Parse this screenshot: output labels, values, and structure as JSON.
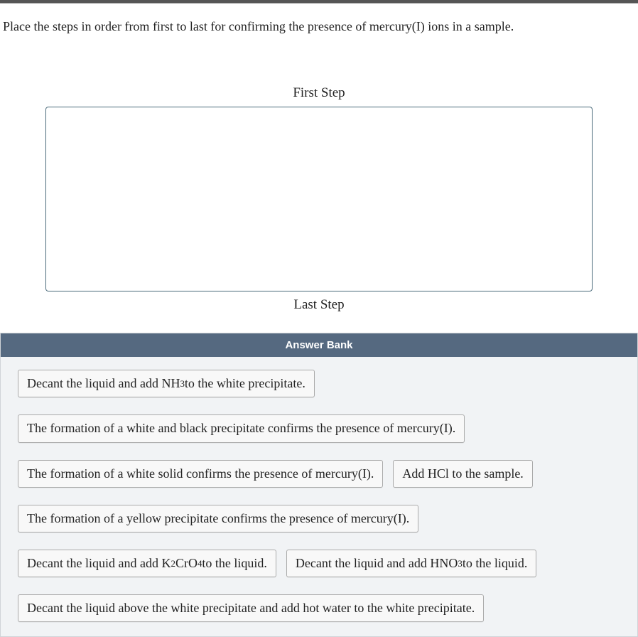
{
  "question": "Place the steps in order from first to last for confirming the presence of mercury(I) ions in a sample.",
  "labels": {
    "first": "First Step",
    "last": "Last Step",
    "bank": "Answer Bank"
  },
  "chips": {
    "c1a": "Decant the liquid and add NH",
    "c1b": " to the white precipitate.",
    "c1sub": "3",
    "c2": "The formation of a white and black precipitate confirms the presence of mercury(I).",
    "c3": "The formation of a white solid confirms the presence of mercury(I).",
    "c4": "Add HCl to the sample.",
    "c5": "The formation of a yellow precipitate confirms the presence of mercury(I).",
    "c6a": "Decant the liquid and add K",
    "c6s1": "2",
    "c6b": "CrO",
    "c6s2": "4",
    "c6c": " to the liquid.",
    "c7a": "Decant the liquid and add HNO",
    "c7s": "3",
    "c7b": " to the liquid.",
    "c8": "Decant the liquid above the white precipitate and add hot water to the white precipitate."
  }
}
